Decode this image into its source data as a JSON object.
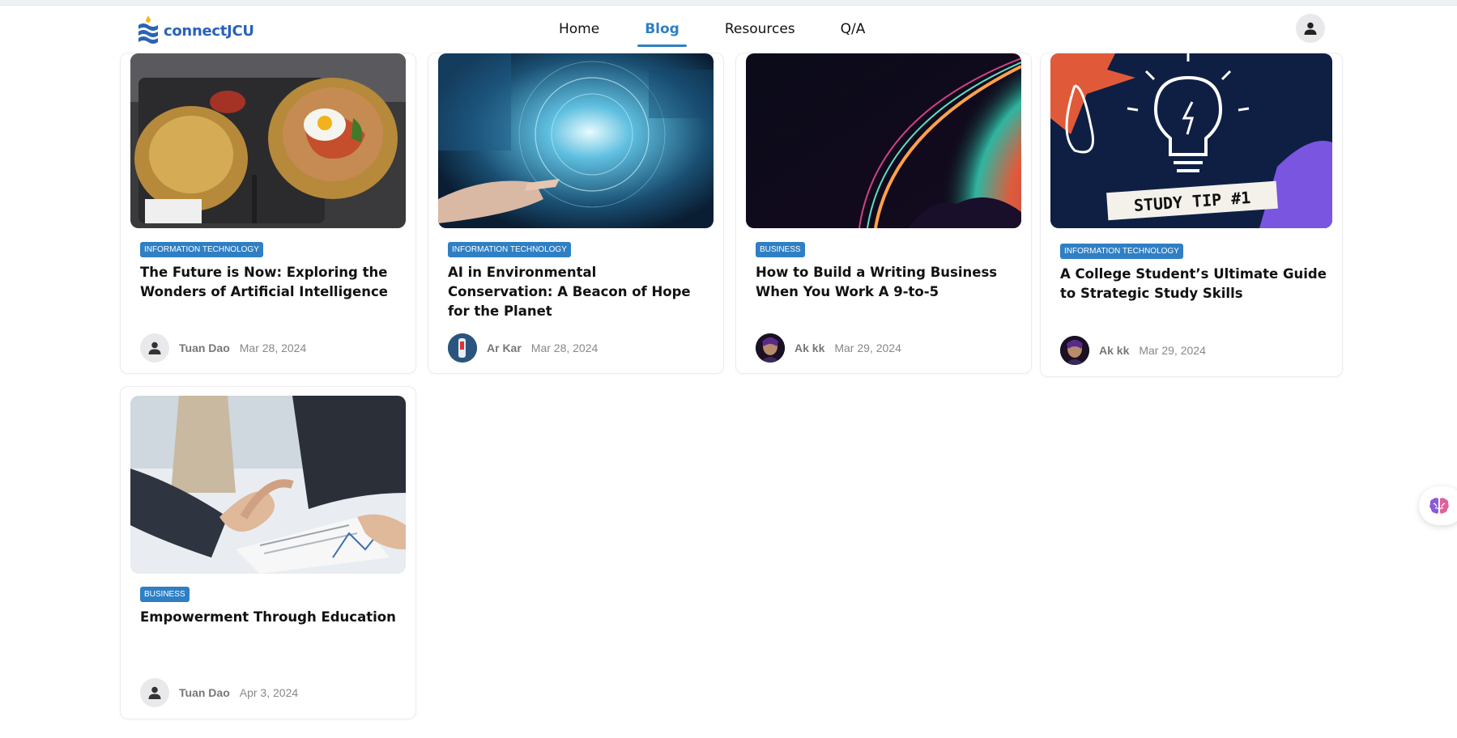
{
  "app": {
    "logo_text": "connectJCU"
  },
  "nav": {
    "items": [
      "Home",
      "Blog",
      "Resources",
      "Q/A"
    ],
    "active": "Blog"
  },
  "posts": [
    {
      "category": "INFORMATION TECHNOLOGY",
      "title": "The Future is Now: Exploring the Wonders of Artificial Intelligence",
      "author": "Tuan Dao",
      "date": "Mar 28, 2024",
      "image": "bibimbap-bowls-photo",
      "avatar": "default-user-icon"
    },
    {
      "category": "INFORMATION TECHNOLOGY",
      "title": "AI in Environmental Conservation: A Beacon of Hope for the Planet",
      "author": "Ar Kar",
      "date": "Mar 28, 2024",
      "image": "digital-network-hand-photo",
      "avatar": "profile-photo"
    },
    {
      "category": "BUSINESS",
      "title": "How to Build a Writing Business When You Work A 9-to-5",
      "author": "Ak kk",
      "date": "Mar 29, 2024",
      "image": "neon-planet-illustration",
      "avatar": "profile-photo"
    },
    {
      "category": "INFORMATION TECHNOLOGY",
      "title": "A College Student’s Ultimate Guide to Strategic Study Skills",
      "author": "Ak kk",
      "date": "Mar 29, 2024",
      "image": "study-tip-lightbulb-illustration",
      "image_text": "STUDY TIP #1",
      "avatar": "profile-photo"
    },
    {
      "category": "BUSINESS",
      "title": "Empowerment Through Education",
      "author": "Tuan Dao",
      "date": "Apr 3, 2024",
      "image": "business-handshake-photo",
      "avatar": "default-user-icon"
    }
  ],
  "colors": {
    "accent": "#2f7fc4",
    "brand": "#2a63b8",
    "card_border": "#ececf0",
    "study_bg": "#0f1f44"
  }
}
